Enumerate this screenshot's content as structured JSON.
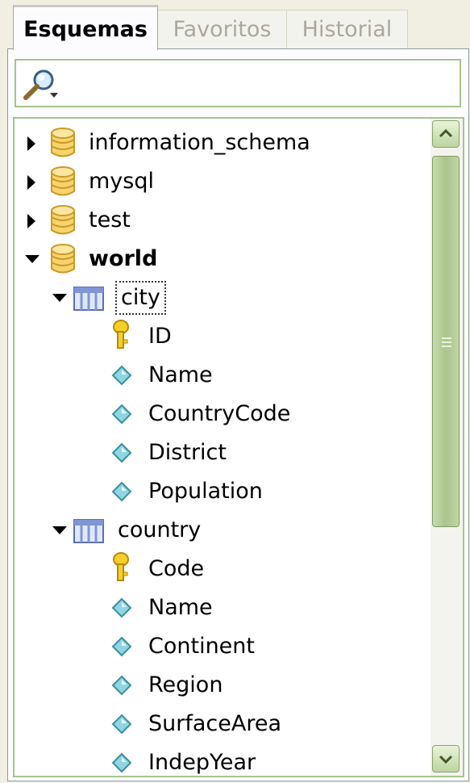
{
  "tabs": [
    {
      "label": "Esquemas",
      "active": true
    },
    {
      "label": "Favoritos",
      "active": false
    },
    {
      "label": "Historial",
      "active": false
    }
  ],
  "search": {
    "icon": "magnifier-icon"
  },
  "tree": {
    "schemas": [
      {
        "name": "information_schema",
        "expanded": false
      },
      {
        "name": "mysql",
        "expanded": false
      },
      {
        "name": "test",
        "expanded": false
      },
      {
        "name": "world",
        "expanded": true
      }
    ],
    "tables": [
      {
        "name": "city",
        "expanded": true,
        "columns": [
          {
            "name": "ID",
            "key": true
          },
          {
            "name": "Name",
            "key": false
          },
          {
            "name": "CountryCode",
            "key": false
          },
          {
            "name": "District",
            "key": false
          },
          {
            "name": "Population",
            "key": false
          }
        ]
      },
      {
        "name": "country",
        "expanded": true,
        "columns": [
          {
            "name": "Code",
            "key": true
          },
          {
            "name": "Name",
            "key": false
          },
          {
            "name": "Continent",
            "key": false
          },
          {
            "name": "Region",
            "key": false
          },
          {
            "name": "SurfaceArea",
            "key": false
          },
          {
            "name": "IndepYear",
            "key": false
          }
        ]
      }
    ]
  },
  "colors": {
    "accent_border": "#a3c48f",
    "scrollbar_thumb": "#aac48c",
    "db_icon": "#f2c95a",
    "table_icon": "#7e95d8",
    "column_icon": "#5ab8c8",
    "key_icon": "#f0c419"
  }
}
